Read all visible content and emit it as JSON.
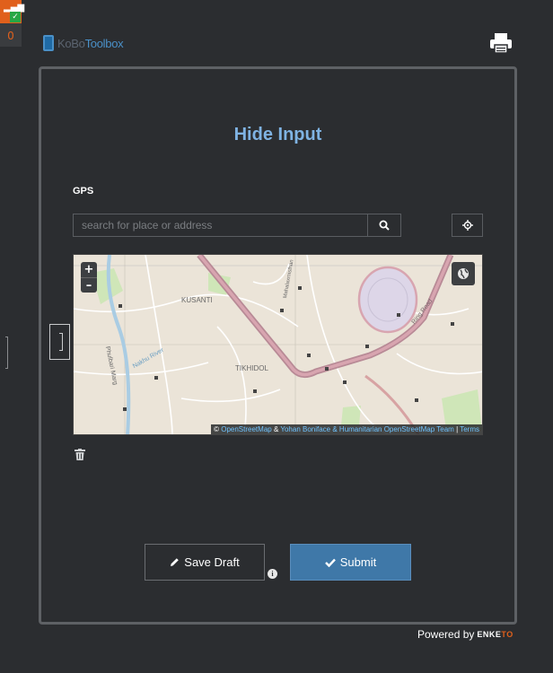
{
  "queue": {
    "count": "0"
  },
  "header": {
    "logo_part1": "KoBo",
    "logo_part2": "Toolbox"
  },
  "form": {
    "title": "Hide Input",
    "gps_label": "GPS",
    "search_placeholder": "search for place or address",
    "map": {
      "zoom_in": "+",
      "zoom_out": "–",
      "labels": [
        "KUSANTI",
        "TIKHIDOL",
        "Ring Road",
        "Mahalaxmisthan",
        "Nakhu River",
        "Phulbari Marg"
      ],
      "attribution": {
        "copy": "©",
        "link1": "OpenStreetMap",
        "amp": "&",
        "link2": "Yohan Boniface & Humanitarian OpenStreetMap Team",
        "sep": "|",
        "link3": "Terms"
      }
    },
    "save_draft_label": "Save Draft",
    "submit_label": "Submit",
    "info_glyph": "i"
  },
  "footer": {
    "powered_by": "Powered by",
    "brand_a": "ENKE",
    "brand_b": "TO"
  },
  "colors": {
    "title": "#7fb3e3",
    "submit": "#3f78a8",
    "accent": "#e0601c",
    "road": "#c27f8a"
  }
}
